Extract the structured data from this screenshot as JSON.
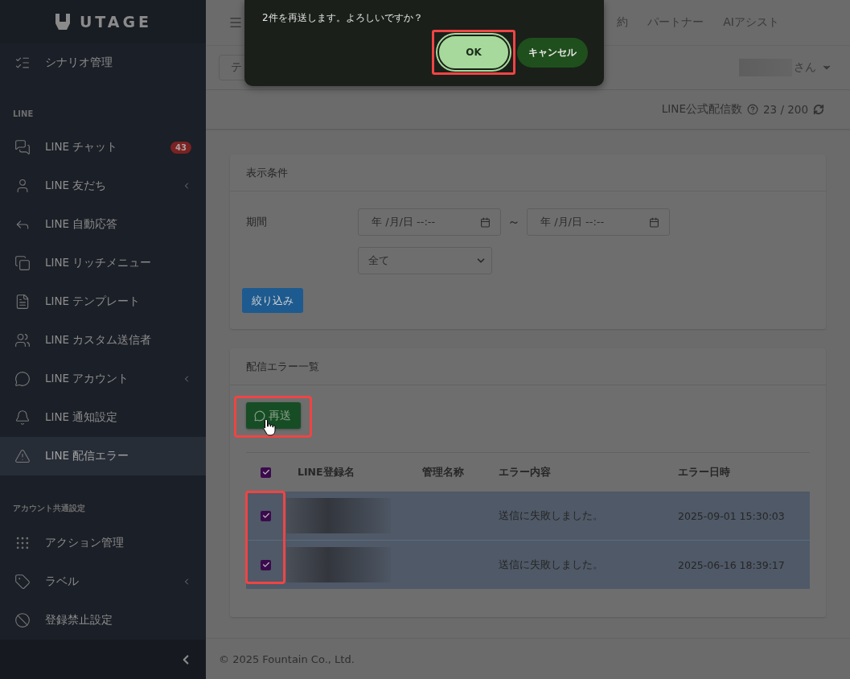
{
  "sidebar": {
    "logo": "UTAGE",
    "groups": [
      {
        "items": [
          {
            "label": "シナリオ管理",
            "expandable": false,
            "selected": false
          }
        ]
      },
      {
        "heading": "LINE",
        "items": [
          {
            "label": "LINE チャット",
            "badge": "43",
            "expandable": false,
            "selected": false
          },
          {
            "label": "LINE 友だち",
            "expandable": true,
            "selected": false
          },
          {
            "label": "LINE 自動応答",
            "expandable": false,
            "selected": false
          },
          {
            "label": "LINE リッチメニュー",
            "expandable": false,
            "selected": false
          },
          {
            "label": "LINE テンプレート",
            "expandable": false,
            "selected": false
          },
          {
            "label": "LINE カスタム送信者",
            "expandable": false,
            "selected": false
          },
          {
            "label": "LINE アカウント",
            "expandable": true,
            "selected": false
          },
          {
            "label": "LINE 通知設定",
            "expandable": false,
            "selected": false
          },
          {
            "label": "LINE 配信エラー",
            "expandable": false,
            "selected": true
          }
        ]
      },
      {
        "heading": "アカウント共通設定",
        "items": [
          {
            "label": "アクション管理",
            "expandable": false,
            "selected": false
          },
          {
            "label": "ラベル",
            "expandable": true,
            "selected": false
          },
          {
            "label": "登録禁止設定",
            "expandable": false,
            "selected": false
          }
        ]
      }
    ]
  },
  "top_nav": [
    "約",
    "パートナー",
    "AIアシスト"
  ],
  "header": {
    "button_partial": "テ",
    "user_suffix": "さん"
  },
  "stats": {
    "label": "LINE公式配信数",
    "value": "23 / 200"
  },
  "filter_card": {
    "title": "表示条件",
    "period_label": "期間",
    "date_from": "年 /月/日 --:--",
    "separator": "～",
    "date_to": "年 /月/日 --:--",
    "select": "全て",
    "submit": "絞り込み"
  },
  "error_card": {
    "title": "配信エラー一覧",
    "resend": "再送",
    "all_checked": true,
    "columns": [
      "LINE登録名",
      "管理名称",
      "エラー内容",
      "エラー日時"
    ],
    "rows": [
      {
        "checked": true,
        "error": "送信に失敗しました。",
        "time": "2025-09-01 15:30:03"
      },
      {
        "checked": true,
        "error": "送信に失敗しました。",
        "time": "2025-06-16 18:39:17"
      }
    ]
  },
  "footer": "© 2025 Fountain Co., Ltd.",
  "dialog": {
    "message": "2件を再送します。よろしいですか？",
    "ok": "OK",
    "cancel": "キャンセル"
  }
}
